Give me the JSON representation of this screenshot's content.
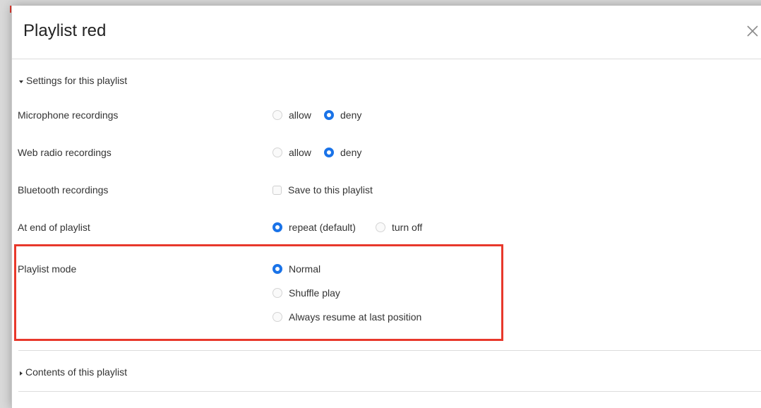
{
  "dialog": {
    "title": "Playlist red",
    "close_icon": "close-icon"
  },
  "settings": {
    "toggle_label": "Settings for this playlist",
    "expanded": true,
    "microphone": {
      "label": "Microphone recordings",
      "options": [
        "allow",
        "deny"
      ],
      "selected": "deny"
    },
    "web_radio": {
      "label": "Web radio recordings",
      "options": [
        "allow",
        "deny"
      ],
      "selected": "deny"
    },
    "bluetooth": {
      "label": "Bluetooth recordings",
      "checkbox_label": "Save to this playlist",
      "checked": false
    },
    "end_of_playlist": {
      "label": "At end of playlist",
      "options": [
        "repeat (default)",
        "turn off"
      ],
      "selected": "repeat (default)"
    },
    "playlist_mode": {
      "label": "Playlist mode",
      "options": [
        "Normal",
        "Shuffle play",
        "Always resume at last position"
      ],
      "selected": "Normal"
    }
  },
  "contents": {
    "toggle_label": "Contents of this playlist",
    "expanded": false
  },
  "colors": {
    "accent": "#1a73e8",
    "highlight_border": "#e8382b"
  }
}
